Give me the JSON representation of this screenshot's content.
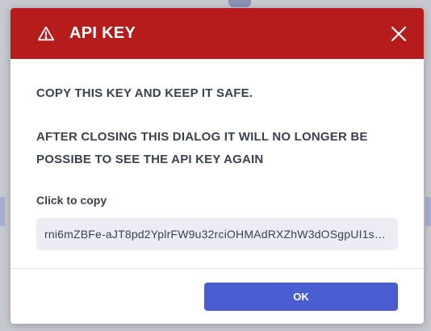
{
  "dialog": {
    "title": "API KEY",
    "warning_line_1": "COPY THIS KEY AND KEEP IT SAFE.",
    "warning_line_2": "AFTER CLOSING THIS DIALOG IT WILL NO LONGER BE POSSIBE TO SEE THE API KEY AGAIN",
    "copy_label": "Click to copy",
    "api_key": "rni6mZBFe-aJT8pd2YplrFW9u32rciOHMAdRXZhW3dOSgpUI1s…",
    "ok_label": "OK"
  },
  "icons": {
    "header_icon": "warning-triangle-icon",
    "close_icon": "close-icon"
  },
  "colors": {
    "header_bg": "#b71c1c",
    "primary_button": "#4a5dd0",
    "key_box_bg": "#ecedf4",
    "text": "#3a4150"
  }
}
